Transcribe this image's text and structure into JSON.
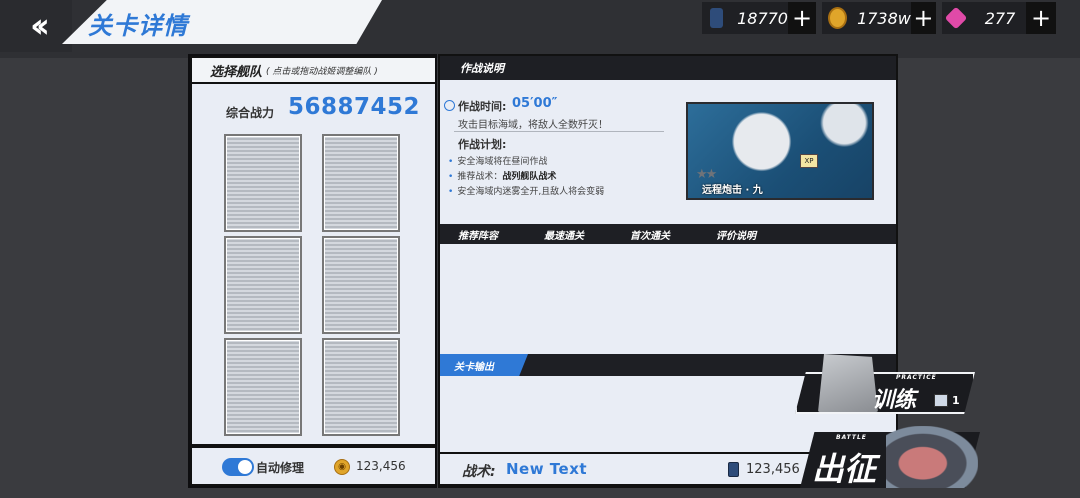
{
  "header": {
    "back_icon": "double-chevron-left-icon",
    "title": "关卡详情"
  },
  "resources": [
    {
      "name": "oil",
      "icon": "oil-barrel-icon",
      "value": "18770",
      "plus": "+"
    },
    {
      "name": "coin",
      "icon": "coin-icon",
      "value": "1738w",
      "plus": "+"
    },
    {
      "name": "gem",
      "icon": "gem-icon",
      "value": "277",
      "plus": "+"
    }
  ],
  "fleet": {
    "title": "选择舰队",
    "subtitle": "( 点击或拖动战姬调整编队 )",
    "power_label": "综合战力",
    "power_value": "56887452",
    "auto_repair_label": "自动修理",
    "auto_repair_on": true,
    "repair_cost": "123,456"
  },
  "battle": {
    "header": "作战说明",
    "time_label": "作战时间:",
    "time_value": "05′00″",
    "objective": "攻击目标海域，将敌人全数歼灭！",
    "plan_title": "作战计划:",
    "plan_items": [
      {
        "text": "安全海域将在昼间作战",
        "highlight": ""
      },
      {
        "text": "推荐战术：",
        "highlight": "战列舰队战术"
      },
      {
        "text": "安全海域内迷雾全开,且敌人将会变弱",
        "highlight": ""
      }
    ],
    "map_name": "远程炮击 · 九",
    "map_badge": "XP",
    "stars": "★★"
  },
  "tabs": [
    "推荐阵容",
    "最速通关",
    "首次通关",
    "评价说明"
  ],
  "drops_header": "关卡输出",
  "tactic": {
    "label": "战术:",
    "value": "New Text",
    "cost": "123,456"
  },
  "buttons": {
    "practice_en": "PRACTICE",
    "practice_cn": "训练",
    "practice_count": "1",
    "sortie_en": "BATTLE",
    "sortie_cn": "出征"
  },
  "colors": {
    "accent": "#2f79d6",
    "panel": "#e9edf5",
    "dark": "#1e1f24"
  }
}
